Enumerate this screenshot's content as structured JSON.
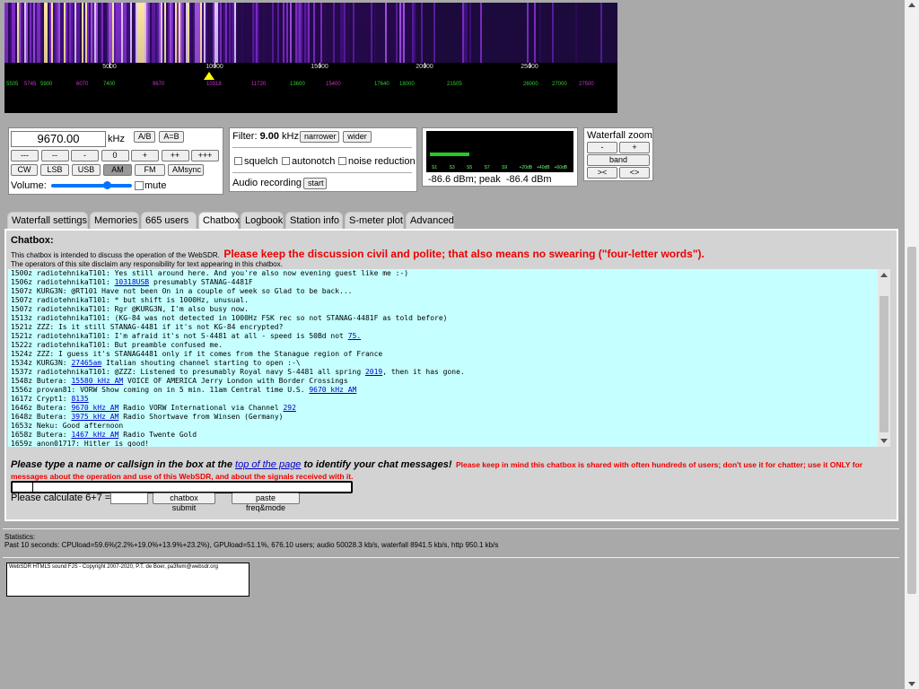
{
  "scale": {
    "ticks": [
      {
        "label": "5000"
      },
      {
        "label": "10000"
      },
      {
        "label": "15000"
      },
      {
        "label": "20000"
      },
      {
        "label": "25000"
      }
    ],
    "markers": [
      {
        "text": "5505",
        "color": "#3c3"
      },
      {
        "text": "5745",
        "color": "#c3c"
      },
      {
        "text": "5900",
        "color": "#3c3"
      },
      {
        "text": "6070",
        "color": "#c3c"
      },
      {
        "text": "7400",
        "color": "#3c3"
      },
      {
        "text": "9670",
        "color": "#c3c"
      },
      {
        "text": "10318",
        "color": "#c3c"
      },
      {
        "text": "11720",
        "color": "#c3c"
      },
      {
        "text": "13600",
        "color": "#3c3"
      },
      {
        "text": "15400",
        "color": "#c3c"
      },
      {
        "text": "17640",
        "color": "#3c3"
      },
      {
        "text": "18000",
        "color": "#3c3"
      },
      {
        "text": "21505",
        "color": "#3c3"
      },
      {
        "text": "26000",
        "color": "#3c3"
      },
      {
        "text": "27000",
        "color": "#3c3"
      },
      {
        "text": "27500",
        "color": "#c3c"
      }
    ]
  },
  "tuning": {
    "frequency": "9670.00",
    "unit": "kHz",
    "ab": "A/B",
    "a_eq_b": "A=B",
    "steps": [
      "---",
      "--",
      "-",
      "0",
      "+",
      "++",
      "+++"
    ],
    "modes": [
      {
        "label": "CW",
        "active": false
      },
      {
        "label": "LSB",
        "active": false
      },
      {
        "label": "USB",
        "active": false
      },
      {
        "label": "AM",
        "active": true
      },
      {
        "label": "FM",
        "active": false
      },
      {
        "label": "AMsync",
        "active": false
      }
    ],
    "volume_label": "Volume:",
    "mute_label": "mute"
  },
  "filter": {
    "label": "Filter:",
    "value": "9.00",
    "unit": "kHz",
    "narrower": "narrower",
    "wider": "wider",
    "squelch": "squelch",
    "autonotch": "autonotch",
    "noise_reduction": "noise reduction",
    "recording_label": "Audio recording",
    "start": "start"
  },
  "smeter": {
    "scale": [
      "S1",
      "S3",
      "S5",
      "S7",
      "S9",
      "+20dB",
      "+40dB",
      "+60dB"
    ],
    "level": 0.28,
    "readout": "-86.6 dBm; peak  -86.4 dBm"
  },
  "zoom": {
    "title": "Waterfall zoom",
    "minus": "-",
    "plus": "+",
    "band": "band",
    "left": "><",
    "right": "<>"
  },
  "tabs": [
    "Waterfall settings",
    "Memories",
    "665 users",
    "Chatbox",
    "Logbook",
    "Station info",
    "S-meter plot",
    "Advanced"
  ],
  "active_tab": "Chatbox",
  "chat": {
    "title": "Chatbox:",
    "intro": "This chatbox is intended to discuss the operation of the WebSDR.",
    "warning": "Please keep the discussion civil and polite; that also means no swearing (\"four-letter words\").",
    "disclaimer": "The operators of this site disclaim any responsibility for text appearing in this chatbox.",
    "lines": [
      {
        "pre": "1500z radiotehnikaT101: Yes still around here. And you're also now evening guest like me :-)",
        "link": "",
        "post": ""
      },
      {
        "pre": "1506z radiotehnikaT101: ",
        "link": "10318USB",
        "post": " presumably STANAG-4481F"
      },
      {
        "pre": "1507z KURG3N: @RT101 Have not been On in a couple of week so Glad to be back...",
        "link": "",
        "post": ""
      },
      {
        "pre": "1507z radiotehnikaT101: * but shift is 1000Hz, unusual.",
        "link": "",
        "post": ""
      },
      {
        "pre": "1507z radiotehnikaT101: Rgr @KURG3N, I'm also busy now.",
        "link": "",
        "post": ""
      },
      {
        "pre": "1513z radiotehnikaT101: (KG-84 was not detected in 1000Hz FSK rec so not STANAG-4481F as told before)",
        "link": "",
        "post": ""
      },
      {
        "pre": "1521z ZZZ: Is it still STANAG-4481 if it's not KG-84 encrypted?",
        "link": "",
        "post": ""
      },
      {
        "pre": "1521z radiotehnikaT101: I'm afraid it's not S-4481 at all - speed is 50Bd not ",
        "link": "75.",
        "post": ""
      },
      {
        "pre": "1522z radiotehnikaT101: But preamble confused me.",
        "link": "",
        "post": ""
      },
      {
        "pre": "1524z ZZZ: I guess it's STANAG4481 only if it comes from the Stanague region of France",
        "link": "",
        "post": ""
      },
      {
        "pre": "1534z KURG3N: ",
        "link": "27465am",
        "post": " Italian shouting channel starting to open :-\\"
      },
      {
        "pre": "1537z radiotehnikaT101: @ZZZ: Listened to presumably Royal navy S-4481 all spring ",
        "link": "2019",
        "post": ", then it has gone."
      },
      {
        "pre": "1548z Butera: ",
        "link": "15580 kHz AM",
        "post": " VOICE OF AMERICA Jerry London with Border Crossings"
      },
      {
        "pre": "1556z provan81: VORW Show coming on in 5 min. 11am Central time U.S. ",
        "link": "9670 kHz AM",
        "post": ""
      },
      {
        "pre": "1617z Crypt1: ",
        "link": "8135",
        "post": ""
      },
      {
        "pre": "1646z Butera: ",
        "link": "9670 kHz AM",
        "post": " Radio VORW International via Channel ",
        "link2": "292"
      },
      {
        "pre": "1648z Butera: ",
        "link": "3975 kHz AM",
        "post": " Radio Shortwave from Winsen (Germany)"
      },
      {
        "pre": "1653z Neku: Good afternoon",
        "link": "",
        "post": ""
      },
      {
        "pre": "1658z Butera: ",
        "link": "1467 kHz AM",
        "post": " Radio Twente Gold"
      },
      {
        "pre": "1659z anon01717: Hitler is good!",
        "link": "",
        "post": ""
      }
    ],
    "prompt_before": "Please type a name or callsign in the box at the ",
    "prompt_link": "top of the page",
    "prompt_after": " to identify your chat messages!",
    "prompt_red": "Please keep in mind this chatbox is shared with often hundreds of users; don't use it for chatter; use it ONLY for messages about the operation and use of this WebSDR, and about the signals received with it.",
    "calc_label": "Please calculate 6+7 =",
    "submit": "chatbox submit",
    "paste": "paste freq&mode"
  },
  "stats": {
    "title": "Statistics:",
    "line": "Past 10 seconds: CPUload=59.6%(2.2%+19.0%+13.9%+23.2%), GPUload=51.1%, 676.10 users; audio 50028.3 kb/s, waterfall 8941.5 kb/s, http 950.1 kb/s"
  },
  "footer": "WebSDR HTML5 sound FJS - Copyright 2007-2020, P.T. de Boer, pa3fwm@websdr.org"
}
